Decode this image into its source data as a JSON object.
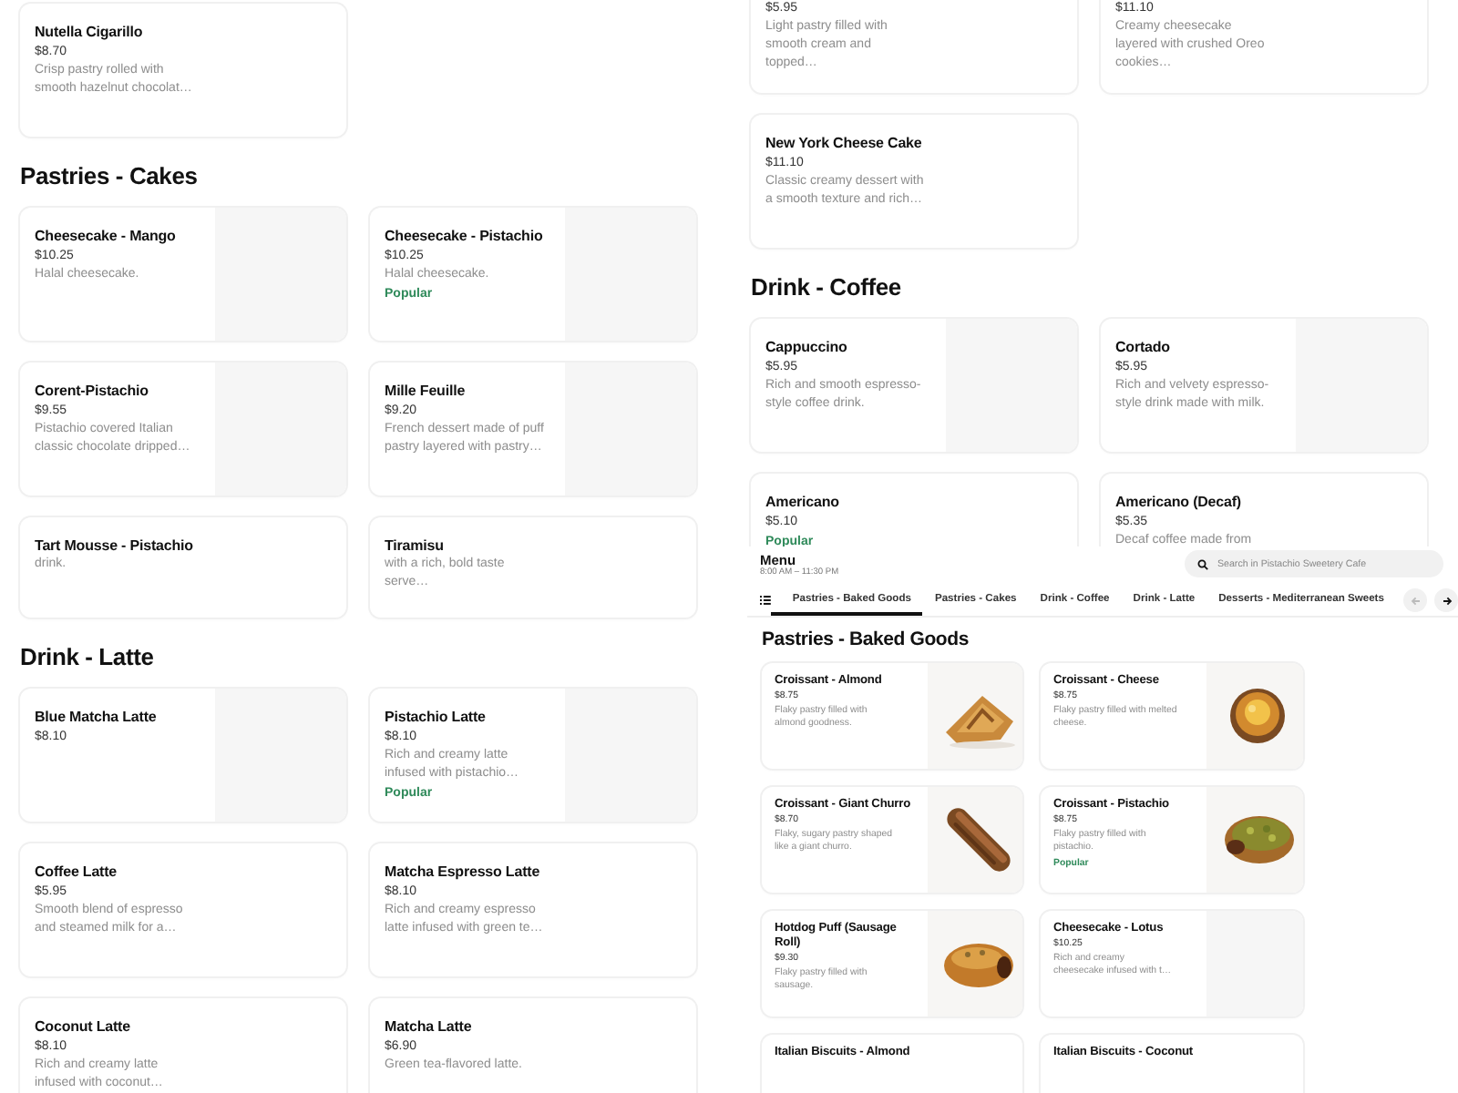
{
  "left_panel": {
    "sections": [
      {
        "cards": [
          {
            "kind": "text",
            "name": "Nutella Cigarillo",
            "price": "$8.70",
            "description": "Crisp pastry rolled with smooth hazelnut chocolat…"
          }
        ]
      },
      {
        "heading": "Pastries - Cakes",
        "cards": [
          {
            "kind": "placeholder",
            "name": "Cheesecake - Mango",
            "price": "$10.25",
            "description": "Halal cheesecake."
          },
          {
            "kind": "placeholder",
            "name": "Cheesecake - Pistachio",
            "price": "$10.25",
            "description": "Halal cheesecake.",
            "badge": "Popular"
          },
          {
            "kind": "placeholder",
            "name": "Corent-Pistachio",
            "price": "$9.55",
            "description": "Pistachio covered Italian classic chocolate dripped…"
          },
          {
            "kind": "placeholder",
            "name": "Mille Feuille",
            "price": "$9.20",
            "description": "French dessert made of puff pastry layered with pastry…"
          },
          {
            "kind": "text",
            "name": "Tart Mousse - Pistachio",
            "description": "drink."
          },
          {
            "kind": "text",
            "name": "Tiramisu",
            "description": "with a rich, bold taste serve…"
          }
        ]
      },
      {
        "heading": "Drink - Latte",
        "cards": [
          {
            "kind": "placeholder",
            "name": "Blue Matcha Latte",
            "price": "$8.10"
          },
          {
            "kind": "placeholder",
            "name": "Pistachio Latte",
            "price": "$8.10",
            "description": "Rich and creamy latte infused with pistachio…",
            "badge": "Popular"
          },
          {
            "kind": "text",
            "name": "Coffee Latte",
            "price": "$5.95",
            "description": "Smooth blend of espresso and steamed milk for a…"
          },
          {
            "kind": "text",
            "name": "Matcha Espresso Latte",
            "price": "$8.10",
            "description": "Rich and creamy espresso latte infused with green te…"
          },
          {
            "kind": "text",
            "name": "Coconut Latte",
            "price": "$8.10",
            "description": "Rich and creamy latte infused with coconut…"
          },
          {
            "kind": "text",
            "name": "Matcha Latte",
            "price": "$6.90",
            "description": "Green tea-flavored latte."
          }
        ]
      }
    ]
  },
  "right_panel": {
    "sections": [
      {
        "cards": [
          {
            "kind": "text",
            "price": "$5.95",
            "description": "Light pastry filled with smooth cream and topped…"
          },
          {
            "kind": "text",
            "price": "$11.10",
            "description": "Creamy cheesecake layered with crushed Oreo cookies…"
          },
          {
            "kind": "text",
            "name": "New York Cheese Cake",
            "price": "$11.10",
            "description": "Classic creamy dessert with a smooth texture and rich…"
          }
        ]
      },
      {
        "heading": "Drink - Coffee",
        "cards": [
          {
            "kind": "placeholder",
            "name": "Cappuccino",
            "price": "$5.95",
            "description": "Rich and smooth espresso-style coffee drink."
          },
          {
            "kind": "placeholder",
            "name": "Cortado",
            "price": "$5.95",
            "description": "Rich and velvety espresso-style drink made with milk."
          },
          {
            "kind": "text",
            "name": "Americano",
            "price": "$5.10",
            "badge": "Popular"
          },
          {
            "kind": "text",
            "name": "Americano (Decaf)",
            "price": "$5.35",
            "description": "Decaf coffee made from"
          }
        ]
      }
    ]
  },
  "menu_panel": {
    "title": "Menu",
    "hours": "8:00 AM – 11:30 PM",
    "search": {
      "placeholder": "Search in Pistachio Sweetery Cafe"
    },
    "tabs": [
      {
        "label": "Pastries - Baked Goods",
        "selected": true
      },
      {
        "label": "Pastries - Cakes",
        "selected": false
      },
      {
        "label": "Drink - Coffee",
        "selected": false
      },
      {
        "label": "Drink - Latte",
        "selected": false
      },
      {
        "label": "Desserts - Mediterranean Sweets",
        "selected": false
      }
    ],
    "tab_scroll": {
      "back_disabled": true,
      "forward_disabled": false
    },
    "sections": [
      {
        "heading": "Pastries - Baked Goods",
        "cards": [
          {
            "name": "Croissant - Almond",
            "price": "$8.75",
            "description": "Flaky pastry filled with almond goodness."
          },
          {
            "name": "Croissant - Cheese",
            "price": "$8.75",
            "description": "Flaky pastry filled with melted cheese."
          },
          {
            "name": "Croissant - Giant Churro",
            "price": "$8.70",
            "description": "Flaky, sugary pastry shaped like a giant churro."
          },
          {
            "name": "Croissant - Pistachio",
            "price": "$8.75",
            "description": "Flaky pastry filled with pistachio.",
            "badge": "Popular"
          },
          {
            "name": "Hotdog Puff (Sausage Roll)",
            "price": "$9.30",
            "description": "Flaky pastry filled with sausage."
          },
          {
            "kind": "placeholder",
            "name": "Cheesecake - Lotus",
            "price": "$10.25",
            "description": "Rich and creamy cheesecake infused with t…"
          },
          {
            "kind": "text",
            "name": "Italian Biscuits - Almond"
          },
          {
            "kind": "text",
            "name": "Italian Biscuits - Coconut"
          }
        ]
      }
    ]
  }
}
